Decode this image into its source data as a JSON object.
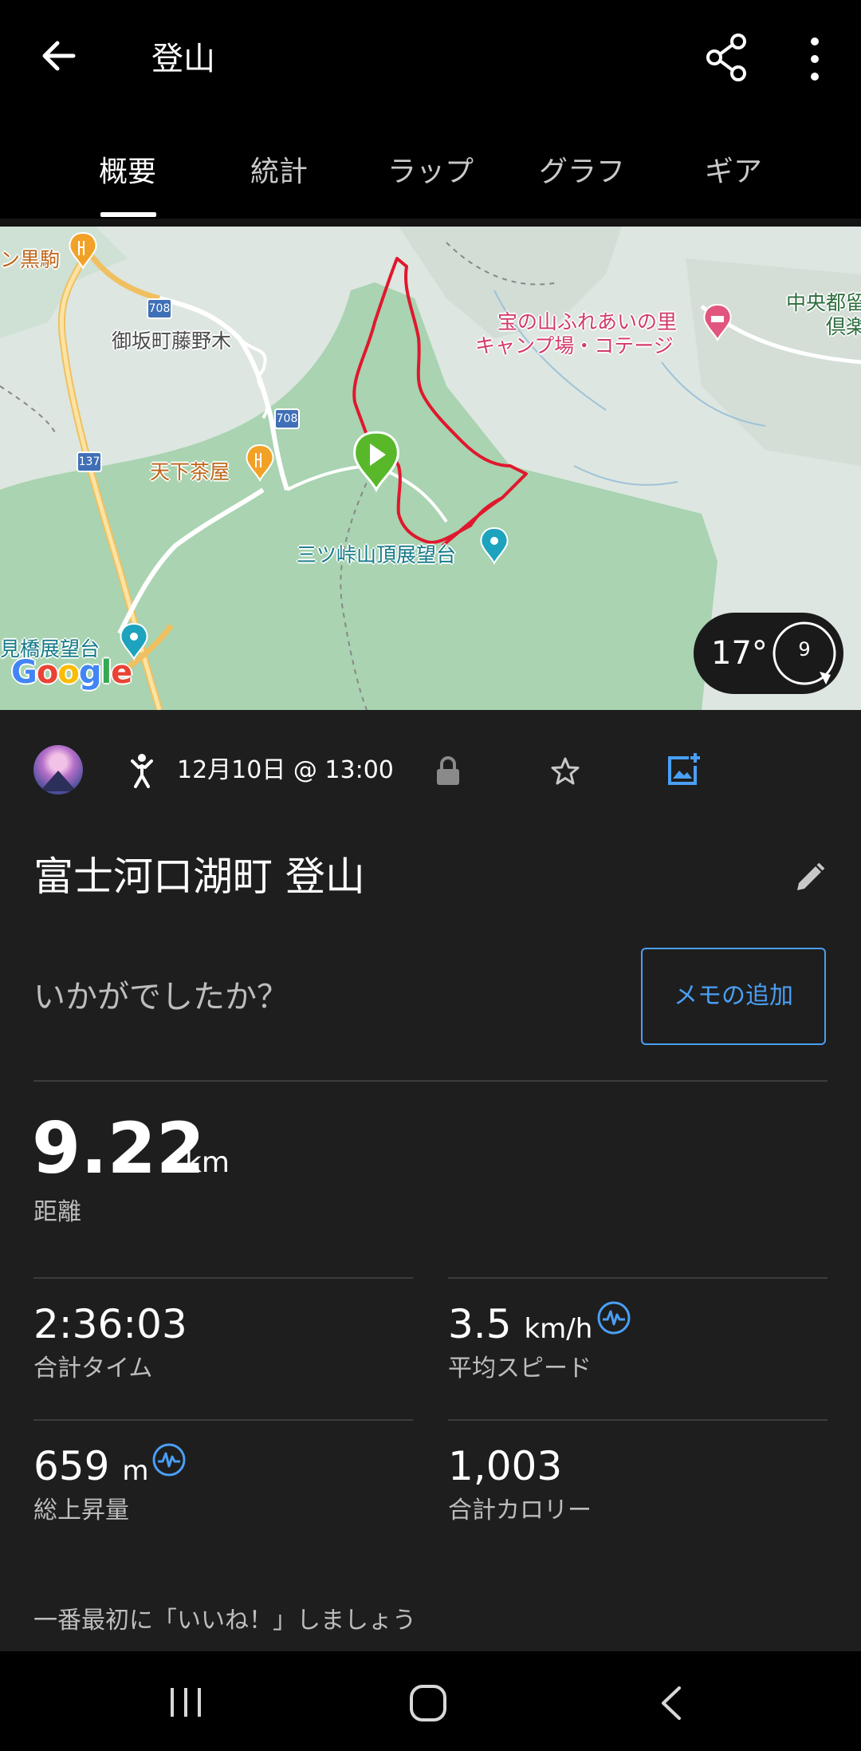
{
  "header": {
    "title": "登山"
  },
  "tabs": [
    {
      "label": "概要",
      "active": true
    },
    {
      "label": "統計",
      "active": false
    },
    {
      "label": "ラップ",
      "active": false
    },
    {
      "label": "グラフ",
      "active": false
    },
    {
      "label": "ギア",
      "active": false
    }
  ],
  "map": {
    "labels": {
      "kurokoma": "ン黒駒",
      "misaka_fujinoki": "御坂町藤野木",
      "tenkachaya": "天下茶屋",
      "camp_line1": "宝の山ふれあいの里",
      "camp_line2": "キャンプ場・コテージ",
      "chuo_line1": "中央都留",
      "chuo_line2": "倶楽",
      "mitsutoge": "三ツ峠山頂展望台",
      "hashi_tenbodai": "見橋展望台",
      "route_708a": "708",
      "route_708b": "708",
      "route_137": "137",
      "google": "Google"
    },
    "weather": {
      "temperature": "17°",
      "wind_speed": "9"
    },
    "colors": {
      "route": "#e0182d",
      "start_marker": "#58b82a",
      "park": "#a9d3b1"
    }
  },
  "activity": {
    "date": "12月10日 @ 13:00",
    "name": "富士河口湖町 登山",
    "memo_prompt": "いかがでしたか？",
    "memo_button": "メモの追加"
  },
  "stats": {
    "distance": {
      "value": "9.22",
      "unit": "km",
      "label": "距離"
    },
    "total_time": {
      "value": "2:36:03",
      "label": "合計タイム"
    },
    "avg_speed": {
      "value": "3.5",
      "unit": "km/h",
      "label": "平均スピード"
    },
    "elevation_gain": {
      "value": "659",
      "unit": "m",
      "label": "総上昇量"
    },
    "calories": {
      "value": "1,003",
      "label": "合計カロリー"
    }
  },
  "like_prompt": "一番最初に「いいね！」しましょう",
  "accent_color": "#4a9ff5"
}
